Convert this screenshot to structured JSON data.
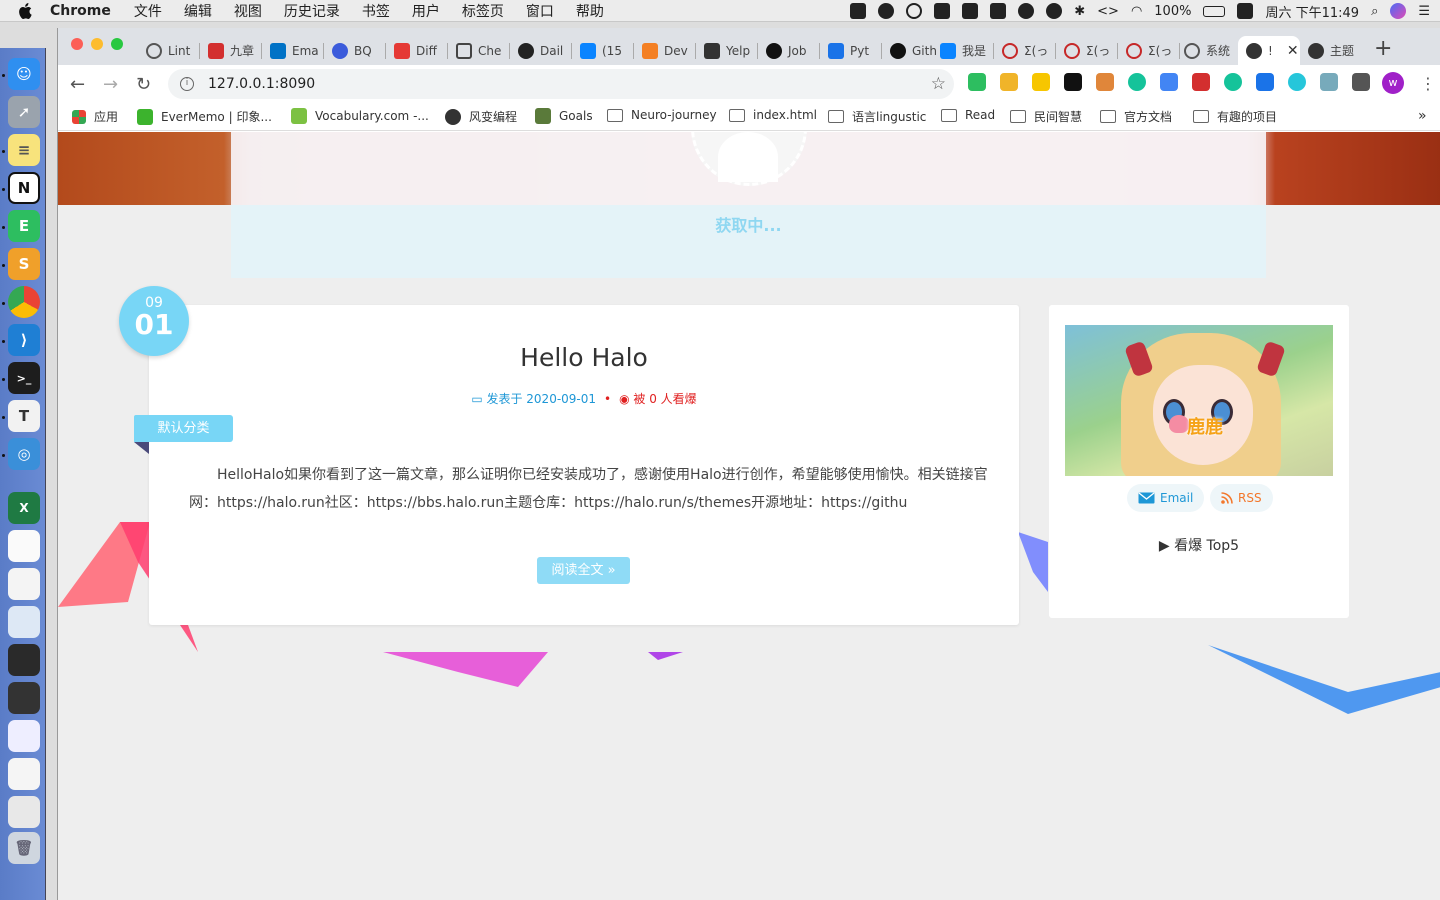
{
  "menubar": {
    "apple": "",
    "app_name": "Chrome",
    "items": [
      "文件",
      "编辑",
      "视图",
      "历史记录",
      "书签",
      "用户",
      "标签页",
      "窗口",
      "帮助"
    ],
    "battery": "100%",
    "clock": "周六 下午11:49"
  },
  "tabs": [
    {
      "label": "Lint",
      "color": "#555"
    },
    {
      "label": "九章",
      "color": "#d32f2f"
    },
    {
      "label": "Ema",
      "color": "#0072c6"
    },
    {
      "label": "BQ",
      "color": "#3b5bdb"
    },
    {
      "label": "Diff",
      "color": "#e53935"
    },
    {
      "label": "Che",
      "color": "#444"
    },
    {
      "label": "Dail",
      "color": "#222"
    },
    {
      "label": "(15",
      "color": "#0a84ff"
    },
    {
      "label": "Dev",
      "color": "#f48024"
    },
    {
      "label": "Yelp",
      "color": "#333"
    },
    {
      "label": "Job",
      "color": "#111"
    },
    {
      "label": "Pyt",
      "color": "#1a73e8"
    },
    {
      "label": "Gith",
      "color": "#111"
    },
    {
      "label": "我是",
      "color": "#0a84ff"
    },
    {
      "label": "Σ(っ",
      "color": "#c62828"
    },
    {
      "label": "Σ(っ",
      "color": "#c62828"
    },
    {
      "label": "Σ(っ",
      "color": "#c62828"
    },
    {
      "label": "系统",
      "color": "#555"
    },
    {
      "label": "!",
      "color": "#333",
      "active": true
    },
    {
      "label": "主题",
      "color": "#333"
    }
  ],
  "address": {
    "url": "127.0.0.1:8090"
  },
  "bookmarks": [
    {
      "label": "应用",
      "type": "apps"
    },
    {
      "label": "EverMemo | 印象...",
      "type": "fav",
      "color": "#3cb32d"
    },
    {
      "label": "Vocabulary.com -...",
      "type": "fav",
      "color": "#7cc142"
    },
    {
      "label": "风变编程",
      "type": "fav",
      "color": "#333"
    },
    {
      "label": "Goals",
      "type": "fav",
      "color": "#5a7a3a"
    },
    {
      "label": "Neuro-journey",
      "type": "folder"
    },
    {
      "label": "index.html",
      "type": "folder"
    },
    {
      "label": "语言lingustic",
      "type": "folder"
    },
    {
      "label": "Read",
      "type": "folder"
    },
    {
      "label": "民间智慧",
      "type": "folder"
    },
    {
      "label": "官方文档",
      "type": "folder"
    },
    {
      "label": "有趣的项目",
      "type": "folder"
    }
  ],
  "bookmarks_overflow": "»",
  "page": {
    "loading_text": "获取中...",
    "post": {
      "month": "09",
      "day": "01",
      "title": "Hello Halo",
      "meta_date": "发表于 2020-09-01",
      "meta_views": "被 0 人看爆",
      "category": "默认分类",
      "excerpt": "HelloHalo如果你看到了这一篇文章，那么证明你已经安装成功了，感谢使用Halo进行创作，希望能够使用愉快。相关链接官网：https://halo.run社区：https://bbs.halo.run主题仓库：https://halo.run/s/themes开源地址：https://githu",
      "read_more": "阅读全文 »"
    },
    "sidebar": {
      "image_caption": "鹿鹿",
      "email_label": "Email",
      "rss_label": "RSS",
      "top5_label": "▶ 看爆 Top5"
    }
  },
  "colors": {
    "accent": "#78d6f6",
    "date_blue": "#1e97d6",
    "views_red": "#e02020",
    "rss_orange": "#f3772b"
  }
}
